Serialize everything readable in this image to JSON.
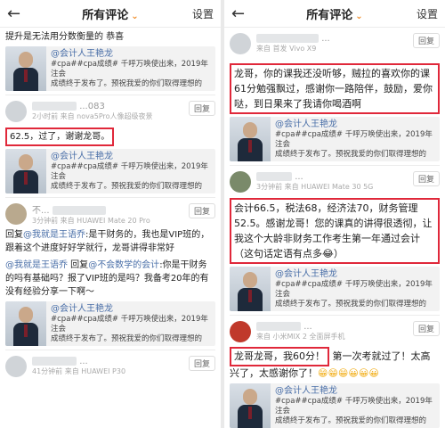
{
  "left": {
    "header": {
      "back_icon": "←",
      "title": "所有评论",
      "chevron": "⌄",
      "settings": "设置"
    },
    "top_text": "提升是无法用分数衡量的 恭喜",
    "card": {
      "name": "@会计人王艳龙",
      "line1": "#cpa##cpa成绩# 千呼万唤使出来，2019年注会",
      "line2": "成绩终于发布了。预祝我爱的你们取得理想的"
    },
    "c1": {
      "uname": "...083",
      "sub": "2小时前  来自 nova5Pro人像超级夜景",
      "reply": "回复",
      "text": "62.5，过了，谢谢龙哥。"
    },
    "c2": {
      "uname": "不...",
      "sub": "3分钟前  来自 HUAWEI Mate 20 Pro",
      "reply": "回复",
      "text_a": "回复",
      "mention1": "@我就是王语乔",
      "text_b": ":是干财务的，我也是VIP班的，跟着这个进度好好学就行，龙哥讲得非常好",
      "mention2": "@我就是王语乔",
      "text_c": " 回复",
      "mention3": "@不会数学的会计",
      "text_d": ":你是干财务的吗有基础吗？报了VIP班的是吗？我备考20年的有没有经验分享一下啊～"
    },
    "c3": {
      "uname": "...",
      "sub": "41分钟前  来自 HUAWEI P30",
      "reply": "回复"
    }
  },
  "right": {
    "header": {
      "back_icon": "←",
      "title": "所有评论",
      "chevron": "⌄",
      "settings": "设置"
    },
    "c0": {
      "uname": "...",
      "sub": "来自 首发 Vivo X9",
      "reply": "回复",
      "text": "龙哥，你的课我还没听够，贼拉的喜欢你的课 61分勉强飘过，感谢你一路陪伴，鼓励，爱你哒，到日果来了我请你喝酒啊"
    },
    "card": {
      "name": "@会计人王艳龙",
      "line1": "#cpa##cpa成绩# 千呼万唤使出来，2019年注会",
      "line2": "成绩终于发布了。预祝我爱的你们取得理想的"
    },
    "c1": {
      "uname": "...",
      "sub": "3分钟前  来自 HUAWEI Mate 30 5G",
      "reply": "回复",
      "text": "会计66.5，税法68，经济法70，财务管理52.5。感谢龙哥！您的课真的讲得很透彻，让我这个大龄非财务工作考生第一年通过会计（这句话定语有点多😂）"
    },
    "c2": {
      "uname": "...",
      "sub": "来自 小米MIX 2 全面屏手机",
      "reply": "回复",
      "text_hl": "龙哥龙哥，我60分！",
      "text_rest": " 第一次考就过了！太高兴了，太感谢你了！",
      "emojis": "😁😁😁😀😀😀"
    }
  }
}
